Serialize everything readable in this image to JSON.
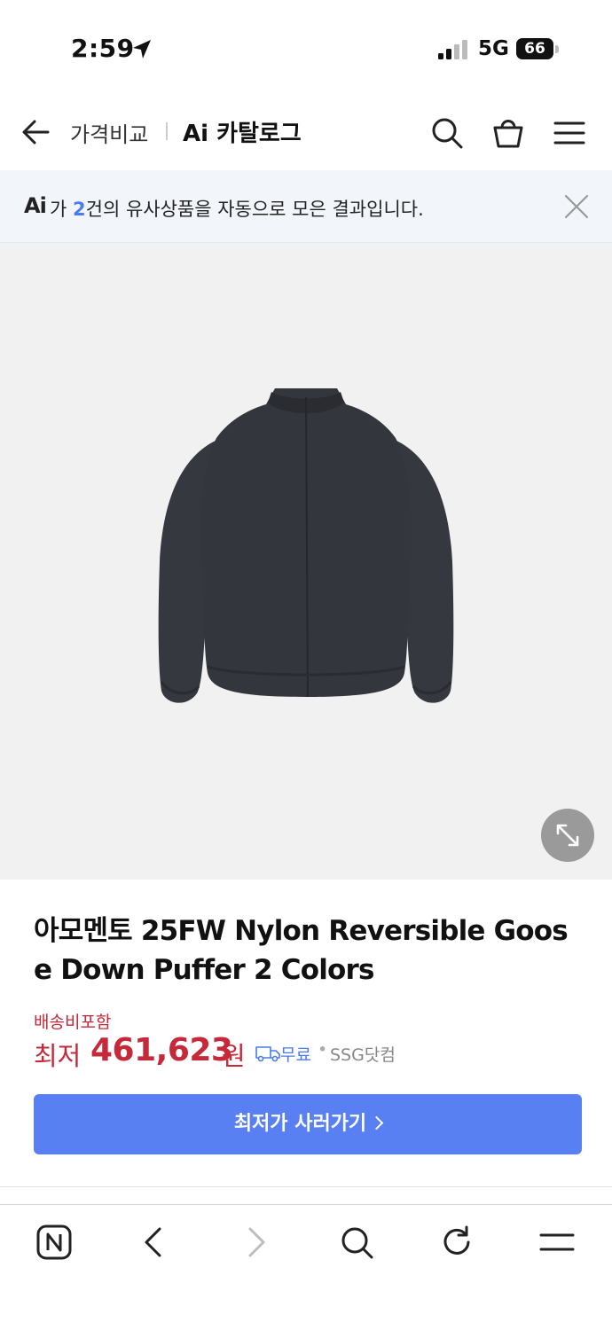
{
  "status_bar": {
    "time": "2:59",
    "network": "5G",
    "battery": "66",
    "icons": [
      "location-arrow-icon",
      "signal-icon",
      "battery-icon"
    ]
  },
  "header": {
    "crumb_primary": "가격비교",
    "crumb_secondary": "Ai 카탈로그",
    "icons": [
      "back-arrow-icon",
      "search-icon",
      "cart-icon",
      "menu-icon"
    ]
  },
  "ai_notice": {
    "logo": "Ai",
    "prefix": "가 ",
    "count": "2",
    "suffix": "건의 유사상품을 자동으로 모은 결과입니다."
  },
  "product": {
    "title": "아모멘토 25FW Nylon Reversible Goose Down Puffer 2 Colors",
    "shipping_included": "배송비포함",
    "price_label": "최저",
    "price_value": "461,623",
    "price_unit": "원",
    "shipping": "무료",
    "separator": "•",
    "seller": "SSG닷컴",
    "buy_button": "최저가 사러가기"
  },
  "colors": {
    "accent": "#5980f3",
    "price": "#c62a3a",
    "notice_bg": "#f2f6fb",
    "jacket": "#33363c"
  },
  "browser_bar": {
    "icons": [
      "naver-home-icon",
      "back-icon",
      "forward-icon",
      "search-icon",
      "refresh-icon",
      "menu-icon"
    ]
  }
}
